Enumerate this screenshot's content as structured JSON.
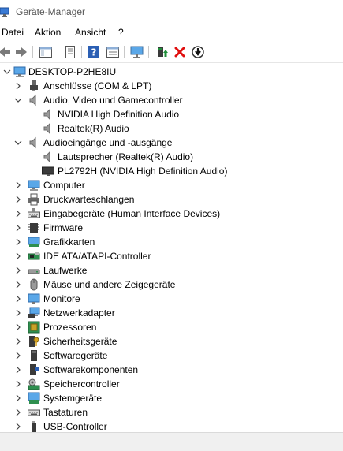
{
  "window": {
    "title": "Geräte-Manager"
  },
  "menu": {
    "datei": "Datei",
    "aktion": "Aktion",
    "ansicht": "Ansicht",
    "help": "?"
  },
  "toolbar": {
    "buttons": [
      "back-icon",
      "forward-icon",
      "show-hide-tree-icon",
      "properties-icon",
      "help-icon",
      "view-icon",
      "scan-hardware-icon",
      "update-driver-icon",
      "uninstall-icon",
      "disable-device-icon"
    ],
    "colors": {
      "help": "#2b5fb4",
      "uninstall": "#e01010",
      "update": "#1f8f3a"
    }
  },
  "tree": {
    "root": "DESKTOP-P2HE8IU",
    "items": [
      {
        "label": "Anschlüsse (COM & LPT)",
        "icon": "port-icon"
      },
      {
        "label": "Audio, Video und Gamecontroller",
        "icon": "speaker-icon"
      },
      {
        "label": "NVIDIA High Definition Audio",
        "icon": "speaker-icon"
      },
      {
        "label": "Realtek(R) Audio",
        "icon": "speaker-icon"
      },
      {
        "label": "Audioeingänge und -ausgänge",
        "icon": "speaker-icon"
      },
      {
        "label": "Lautsprecher (Realtek(R) Audio)",
        "icon": "speaker-icon"
      },
      {
        "label": "PL2792H (NVIDIA High Definition Audio)",
        "icon": "monitor-dark-icon"
      },
      {
        "label": "Computer",
        "icon": "computer-icon"
      },
      {
        "label": "Druckwarteschlangen",
        "icon": "printer-icon"
      },
      {
        "label": "Eingabegeräte (Human Interface Devices)",
        "icon": "hid-icon"
      },
      {
        "label": "Firmware",
        "icon": "firmware-icon"
      },
      {
        "label": "Grafikkarten",
        "icon": "display-adapter-icon"
      },
      {
        "label": "IDE ATA/ATAPI-Controller",
        "icon": "ide-controller-icon"
      },
      {
        "label": "Laufwerke",
        "icon": "disk-drive-icon"
      },
      {
        "label": "Mäuse und andere Zeigegeräte",
        "icon": "mouse-icon"
      },
      {
        "label": "Monitore",
        "icon": "monitor-icon"
      },
      {
        "label": "Netzwerkadapter",
        "icon": "network-adapter-icon"
      },
      {
        "label": "Prozessoren",
        "icon": "processor-icon"
      },
      {
        "label": "Sicherheitsgeräte",
        "icon": "security-device-icon"
      },
      {
        "label": "Softwaregeräte",
        "icon": "software-device-icon"
      },
      {
        "label": "Softwarekomponenten",
        "icon": "software-component-icon"
      },
      {
        "label": "Speichercontroller",
        "icon": "storage-controller-icon"
      },
      {
        "label": "Systemgeräte",
        "icon": "system-device-icon"
      },
      {
        "label": "Tastaturen",
        "icon": "keyboard-icon"
      },
      {
        "label": "USB-Controller",
        "icon": "usb-icon"
      }
    ]
  }
}
